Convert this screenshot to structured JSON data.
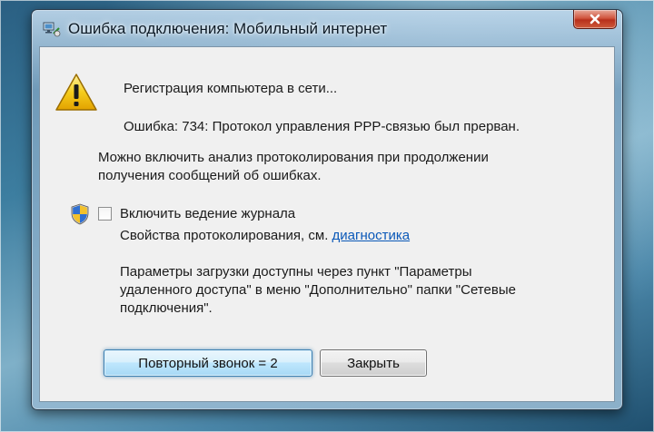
{
  "window": {
    "title": "Ошибка подключения: Мобильный интернет",
    "title_icon": "network-connection-icon",
    "close_icon": "close-icon"
  },
  "message": {
    "icon": "warning-icon",
    "status": "Регистрация компьютера в сети...",
    "error": "Ошибка: 734: Протокол управления PPP-связью был прерван.",
    "analysis_line1": "Можно включить анализ протоколирования при продолжении",
    "analysis_line2": "получения сообщений об ошибках."
  },
  "logging": {
    "icon": "uac-shield-icon",
    "checkbox_label": "Включить ведение журнала",
    "checked": false,
    "properties_prefix": "Свойства протоколирования, см.",
    "properties_link": "диагностика"
  },
  "info": {
    "line1": "Параметры загрузки доступны через пункт \"Параметры",
    "line2": "удаленного доступа\" в меню \"Дополнительно\" папки \"Сетевые",
    "line3": "подключения\"."
  },
  "buttons": {
    "redial": "Повторный звонок = 2",
    "close": "Закрыть"
  },
  "colors": {
    "link": "#0a58b8",
    "warning": "#f2c200",
    "close_button": "#c8442a"
  }
}
